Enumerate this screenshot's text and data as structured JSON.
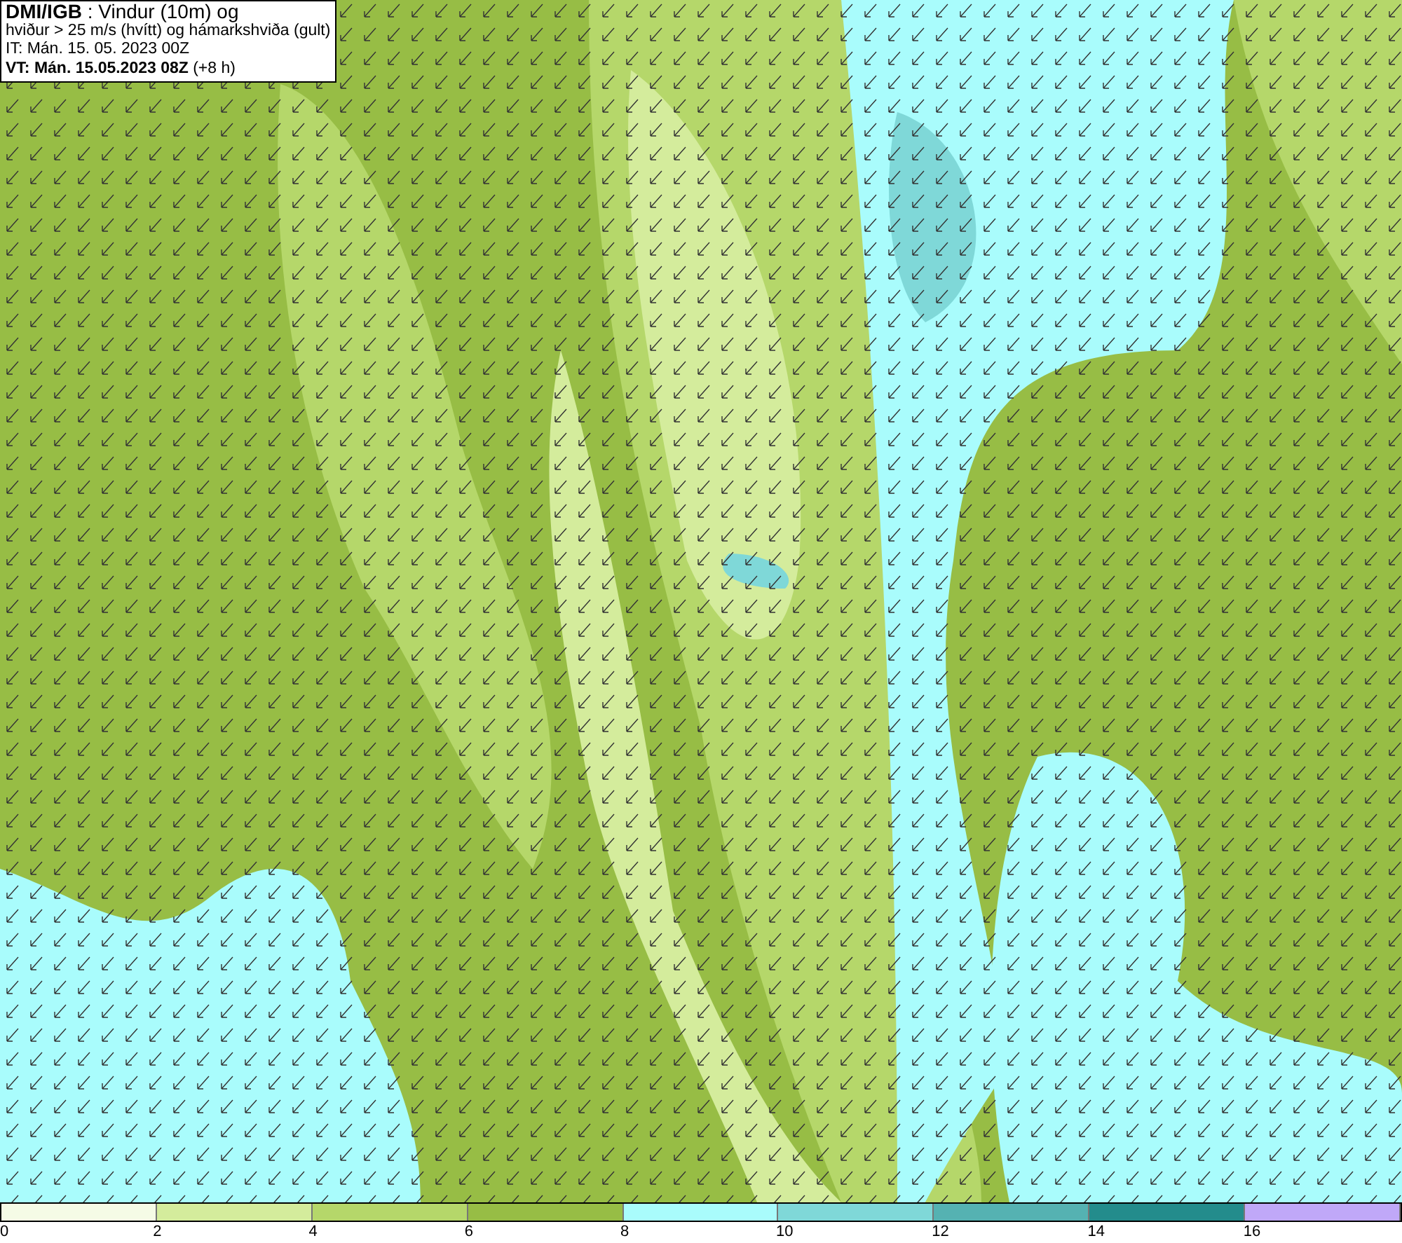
{
  "header": {
    "lines": [
      "**DMI/IGB** : Vindur (10m) og",
      "hviður > 25 m/s (hvítt) og hámarkshviða (gult)",
      "IT: Mán. 15. 05. 2023 00Z",
      "**VT: Mán. 15.05.2023 08Z** (+8 h)"
    ]
  },
  "legend": {
    "bins": [
      {
        "color": "#f5fbe6"
      },
      {
        "color": "#d4ec9c"
      },
      {
        "color": "#b5d76a"
      },
      {
        "color": "#97bd45"
      },
      {
        "color": "#a9fcfc"
      },
      {
        "color": "#7fd8d8"
      },
      {
        "color": "#55b2b2"
      },
      {
        "color": "#238c8c"
      },
      {
        "color": "#c0a8f8"
      }
    ],
    "ticks": [
      "0",
      "2",
      "4",
      "6",
      "8",
      "10",
      "12",
      "14",
      "16"
    ]
  }
}
